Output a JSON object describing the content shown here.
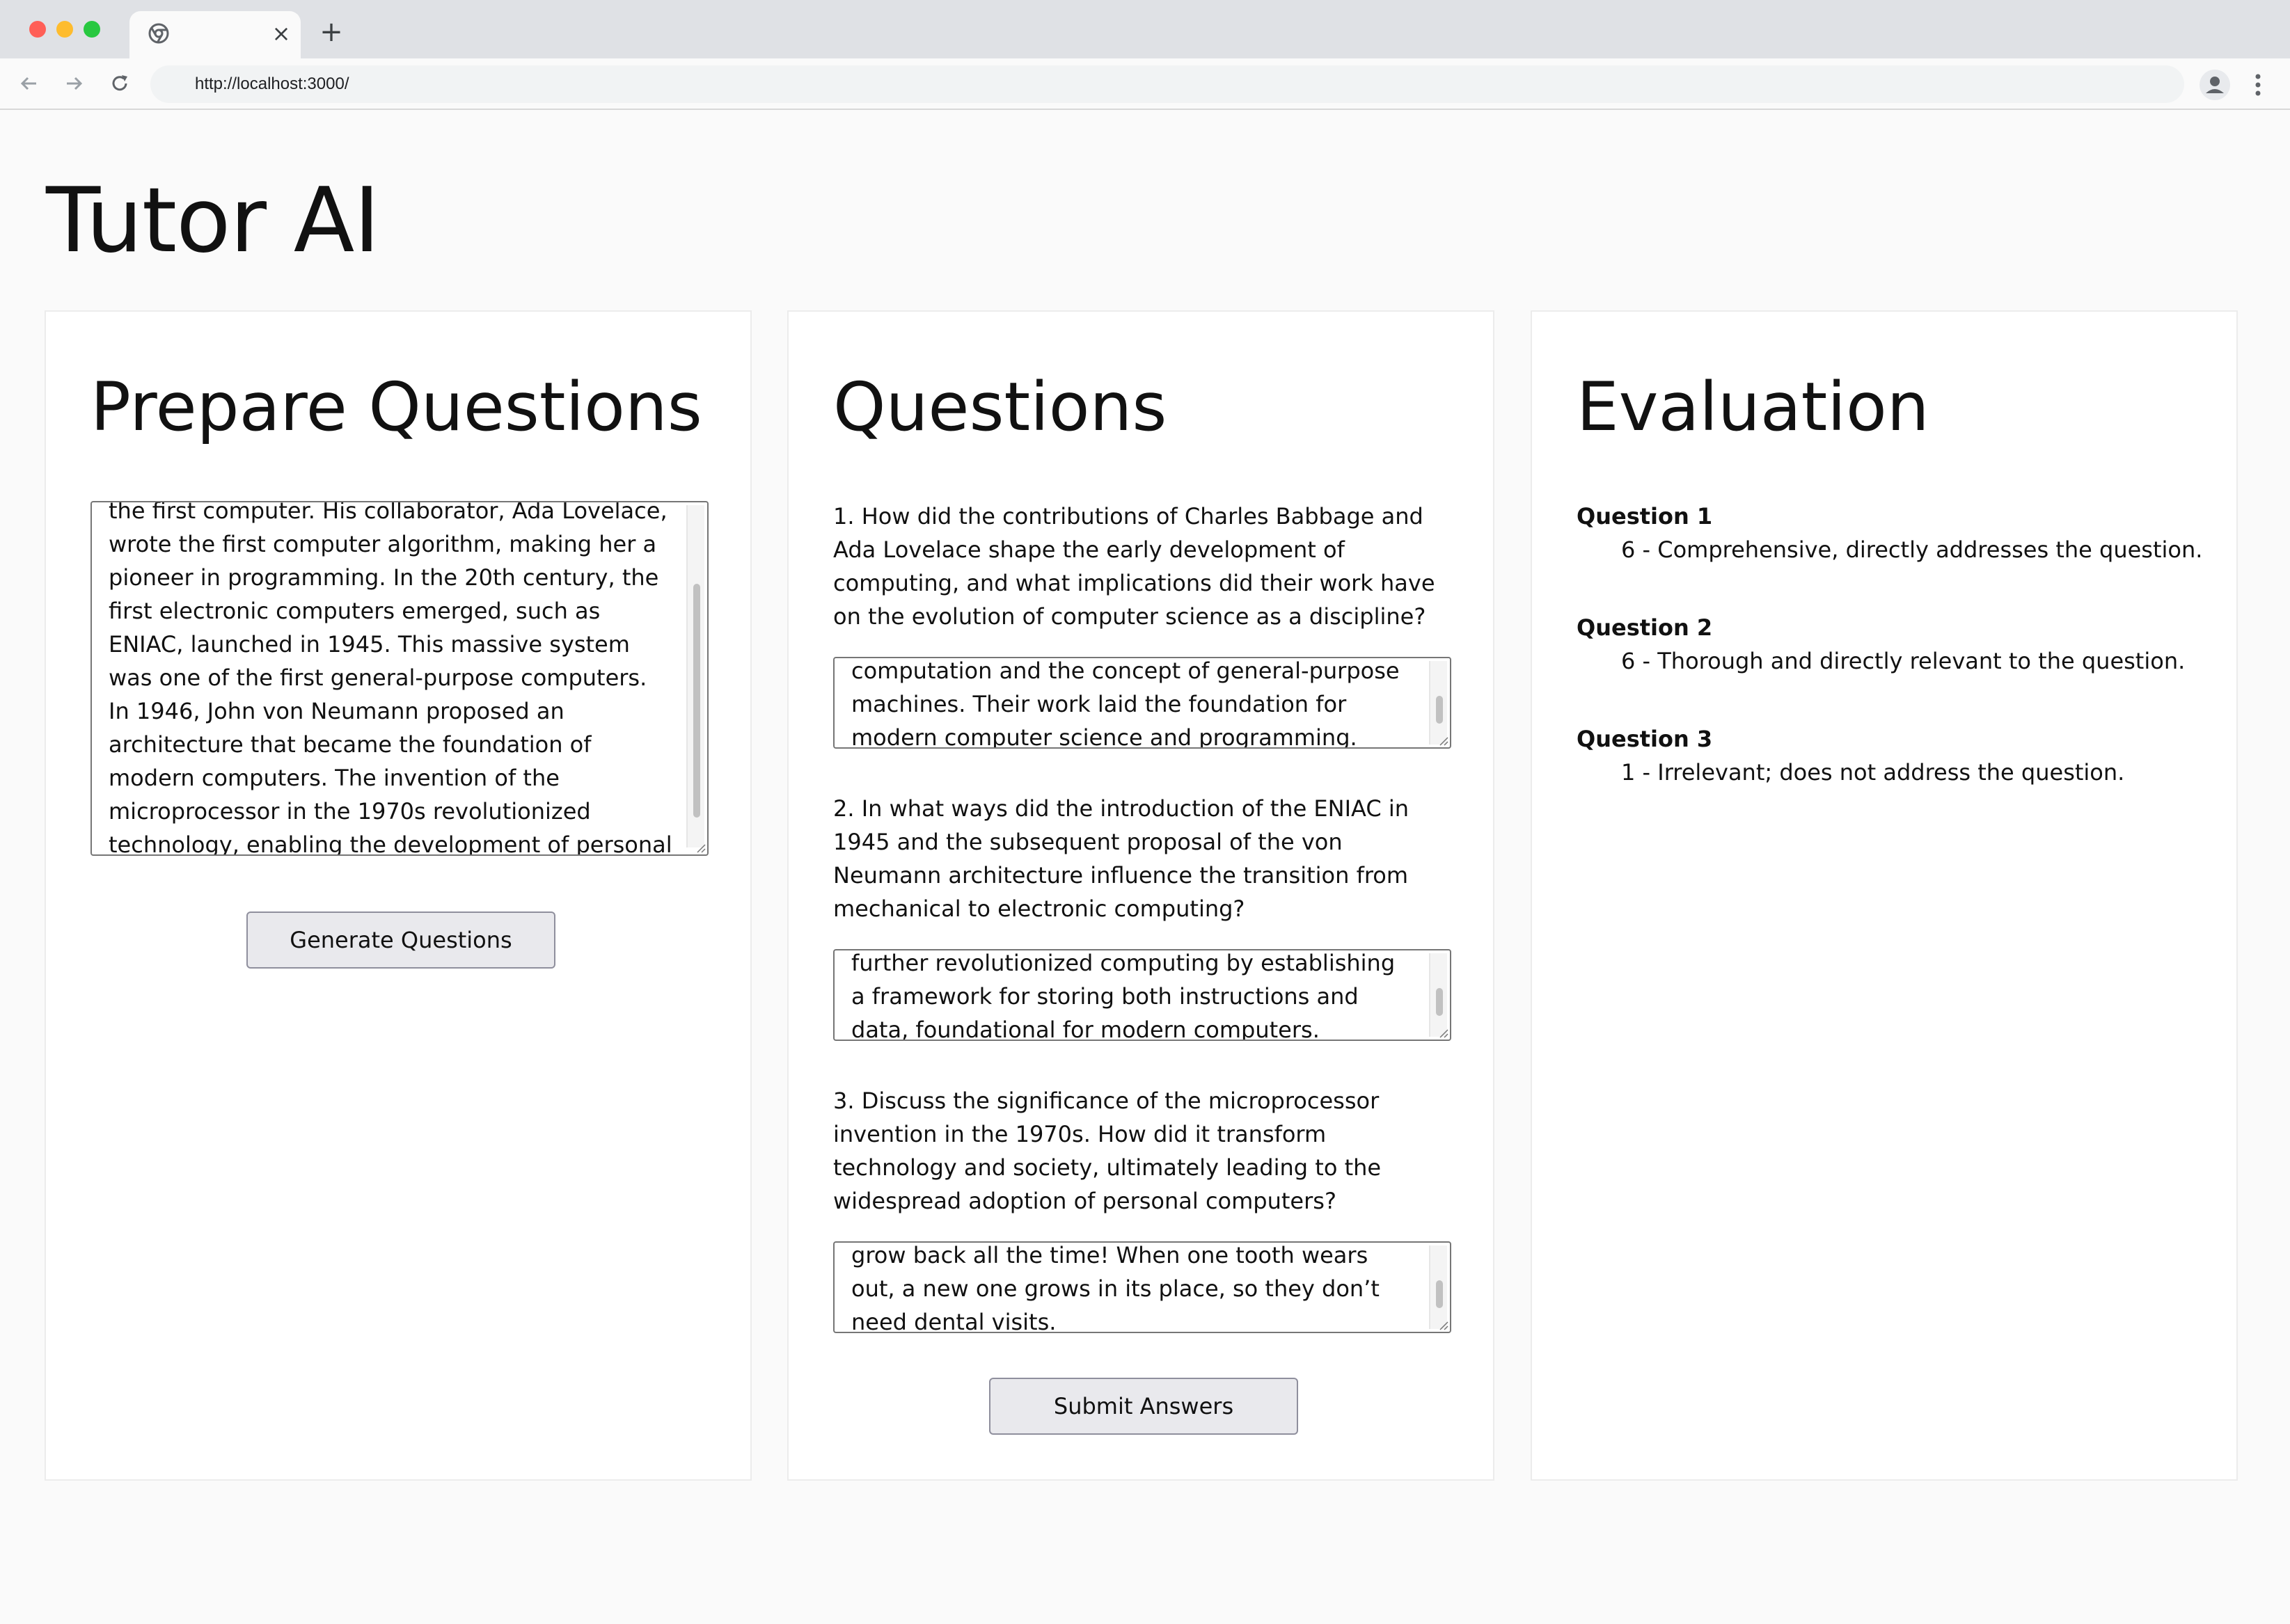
{
  "browser": {
    "url": "http://localhost:3000/",
    "tab_close": "×",
    "new_tab": "+"
  },
  "app": {
    "title": "Tutor AI"
  },
  "prepare": {
    "title": "Prepare Questions",
    "source_text": "the first computer. His collaborator, Ada Lovelace, wrote the first computer algorithm, making her a pioneer in programming. In the 20th century, the first electronic computers emerged, such as ENIAC, launched in 1945. This massive system was one of the first general-purpose computers. In 1946, John von Neumann proposed an architecture that became the foundation of modern computers. The invention of the microprocessor in the 1970s revolutionized technology, enabling the development of personal computers.",
    "scroll_position": 0.75,
    "generate_label": "Generate Questions"
  },
  "questions": {
    "title": "Questions",
    "items": [
      {
        "question": "1. How did the contributions of Charles Babbage and Ada Lovelace shape the early development of computing, and what implications did their work have on the evolution of computer science as a discipline?",
        "answer": "computation and the concept of general-purpose machines. Their work laid the foundation for modern computer science and programming."
      },
      {
        "question": "2. In what ways did the introduction of the ENIAC in 1945 and the subsequent proposal of the von Neumann architecture influence the transition from mechanical to electronic computing?",
        "answer": "further revolutionized computing by establishing a framework for storing both instructions and data, foundational for modern computers."
      },
      {
        "question": "3. Discuss the significance of the microprocessor invention in the 1970s. How did it transform technology and society, ultimately leading to the widespread adoption of personal computers?",
        "answer": "grow back all the time! When one tooth wears out, a new one grows in its place, so they don’t need dental visits."
      }
    ],
    "submit_label": "Submit Answers"
  },
  "evaluation": {
    "title": "Evaluation",
    "items": [
      {
        "label": "Question 1",
        "text": "6 - Comprehensive, directly addresses the question."
      },
      {
        "label": "Question 2",
        "text": "6 - Thorough and directly relevant to the question."
      },
      {
        "label": "Question 3",
        "text": "1 - Irrelevant; does not address the question."
      }
    ]
  }
}
